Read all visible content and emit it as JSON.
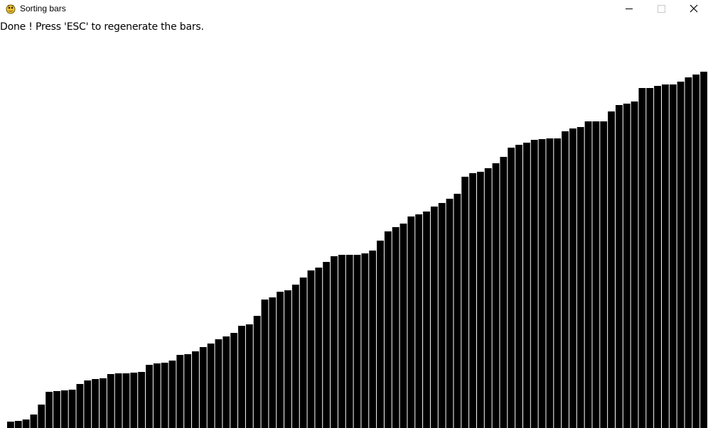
{
  "window": {
    "title": "Sorting bars",
    "buttons": {
      "minimize": "minimize",
      "maximize": "maximize",
      "close": "close"
    }
  },
  "status": {
    "message": "Done ! Press 'ESC' to regenerate the bars."
  },
  "colors": {
    "bar": "#000000",
    "background": "#ffffff"
  },
  "chart_data": {
    "type": "bar",
    "sorted": true,
    "ylim": [
      0,
      500
    ],
    "values": [
      9,
      10,
      12,
      19,
      33,
      52,
      53,
      54,
      55,
      63,
      68,
      70,
      71,
      77,
      78,
      78,
      79,
      80,
      90,
      92,
      93,
      96,
      104,
      105,
      110,
      116,
      121,
      127,
      131,
      136,
      146,
      148,
      160,
      184,
      187,
      195,
      197,
      205,
      215,
      225,
      229,
      237,
      245,
      247,
      247,
      247,
      249,
      254,
      268,
      281,
      287,
      292,
      302,
      305,
      309,
      316,
      321,
      328,
      335,
      359,
      364,
      366,
      371,
      378,
      387,
      401,
      405,
      408,
      412,
      413,
      414,
      414,
      424,
      428,
      430,
      438,
      438,
      438,
      452,
      461,
      463,
      467,
      486,
      486,
      489,
      491,
      491,
      495,
      501,
      505,
      509
    ],
    "heights_px": []
  }
}
